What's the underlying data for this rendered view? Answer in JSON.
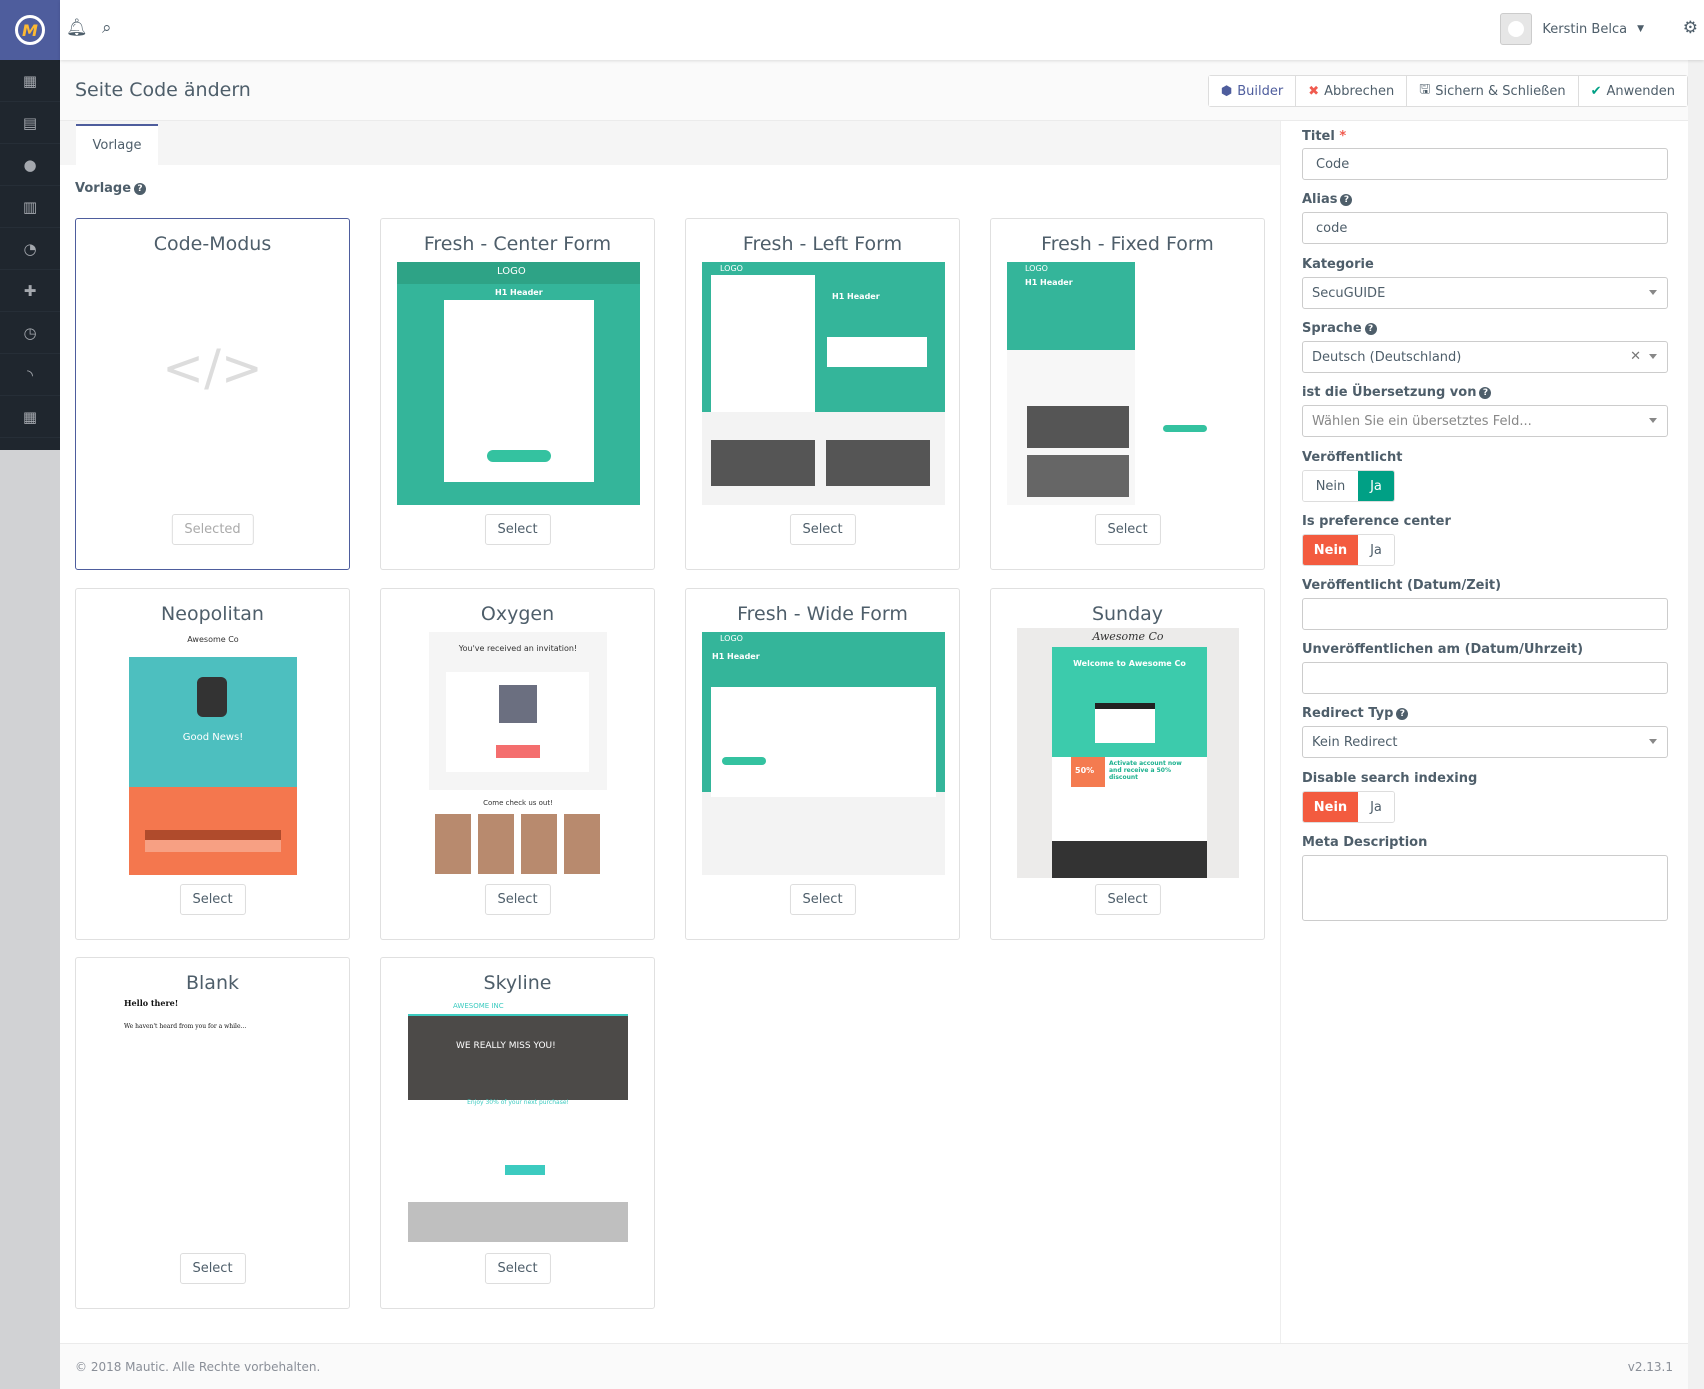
{
  "app": {
    "logo_letter": "M",
    "user_name": "Kerstin Belca"
  },
  "page": {
    "title": "Seite Code ändern"
  },
  "toolbar": {
    "builder": "Builder",
    "cancel": "Abbrechen",
    "save_close": "Sichern & Schließen",
    "apply": "Anwenden"
  },
  "tabs": [
    {
      "label": "Vorlage",
      "active": true
    }
  ],
  "templates_label": "Vorlage",
  "templates": [
    {
      "title": "Code-Modus",
      "button": "Selected",
      "selected": true
    },
    {
      "title": "Fresh - Center Form",
      "button": "Select",
      "preview": {
        "logo": "LOGO",
        "header": "H1 Header"
      }
    },
    {
      "title": "Fresh - Left Form",
      "button": "Select",
      "preview": {
        "logo": "LOGO",
        "header": "H1 Header"
      }
    },
    {
      "title": "Fresh - Fixed Form",
      "button": "Select",
      "preview": {
        "logo": "LOGO",
        "header": "H1 Header"
      }
    },
    {
      "title": "Neopolitan",
      "button": "Select",
      "preview": {
        "brand": "Awesome Co",
        "header": "Good News!"
      }
    },
    {
      "title": "Oxygen",
      "button": "Select",
      "preview": {
        "header": "You've received an invitation!",
        "sub": "Come check us out!"
      }
    },
    {
      "title": "Fresh - Wide Form",
      "button": "Select",
      "preview": {
        "logo": "LOGO",
        "header": "H1 Header"
      }
    },
    {
      "title": "Sunday",
      "button": "Select",
      "preview": {
        "brand": "Awesome Co",
        "header": "Welcome to Awesome Co",
        "badge": "50%",
        "offer": "Activate account now and receive a 50% discount"
      }
    },
    {
      "title": "Blank",
      "button": "Select",
      "preview": {
        "header": "Hello there!",
        "text": "We haven't heard from you for a while..."
      }
    },
    {
      "title": "Skyline",
      "button": "Select",
      "preview": {
        "brand": "AWESOME INC",
        "header": "WE REALLY MISS YOU!",
        "offer": "Enjoy 30% of your next purchase!"
      }
    }
  ],
  "form": {
    "title": {
      "label": "Titel",
      "required": "*",
      "value": "Code"
    },
    "alias": {
      "label": "Alias",
      "value": "code"
    },
    "category": {
      "label": "Kategorie",
      "value": "SecuGUIDE"
    },
    "language": {
      "label": "Sprache",
      "value": "Deutsch (Deutschland)"
    },
    "translation_of": {
      "label": "ist die Übersetzung von",
      "placeholder": "Wählen Sie ein übersetztes Feld..."
    },
    "published": {
      "label": "Veröffentlicht",
      "no": "Nein",
      "yes": "Ja",
      "value": "Ja"
    },
    "preference_center": {
      "label": "Is preference center",
      "no": "Nein",
      "yes": "Ja",
      "value": "Nein"
    },
    "publish_up": {
      "label": "Veröffentlicht (Datum/Zeit)",
      "value": ""
    },
    "publish_down": {
      "label": "Unveröffentlichen am (Datum/Uhrzeit)",
      "value": ""
    },
    "redirect_type": {
      "label": "Redirect Typ",
      "value": "Kein Redirect"
    },
    "no_index": {
      "label": "Disable search indexing",
      "no": "Nein",
      "yes": "Ja",
      "value": "Nein"
    },
    "meta_description": {
      "label": "Meta Description",
      "value": ""
    }
  },
  "footer": {
    "copyright": "© 2018 Mautic. Alle Rechte vorbehalten.",
    "version": "v2.13.1"
  },
  "colors": {
    "brand": "#4e5d9d",
    "sidebar": "#1f262e",
    "success": "#00a085",
    "danger": "#f35b3f",
    "fresh_green": "#34b59a"
  }
}
